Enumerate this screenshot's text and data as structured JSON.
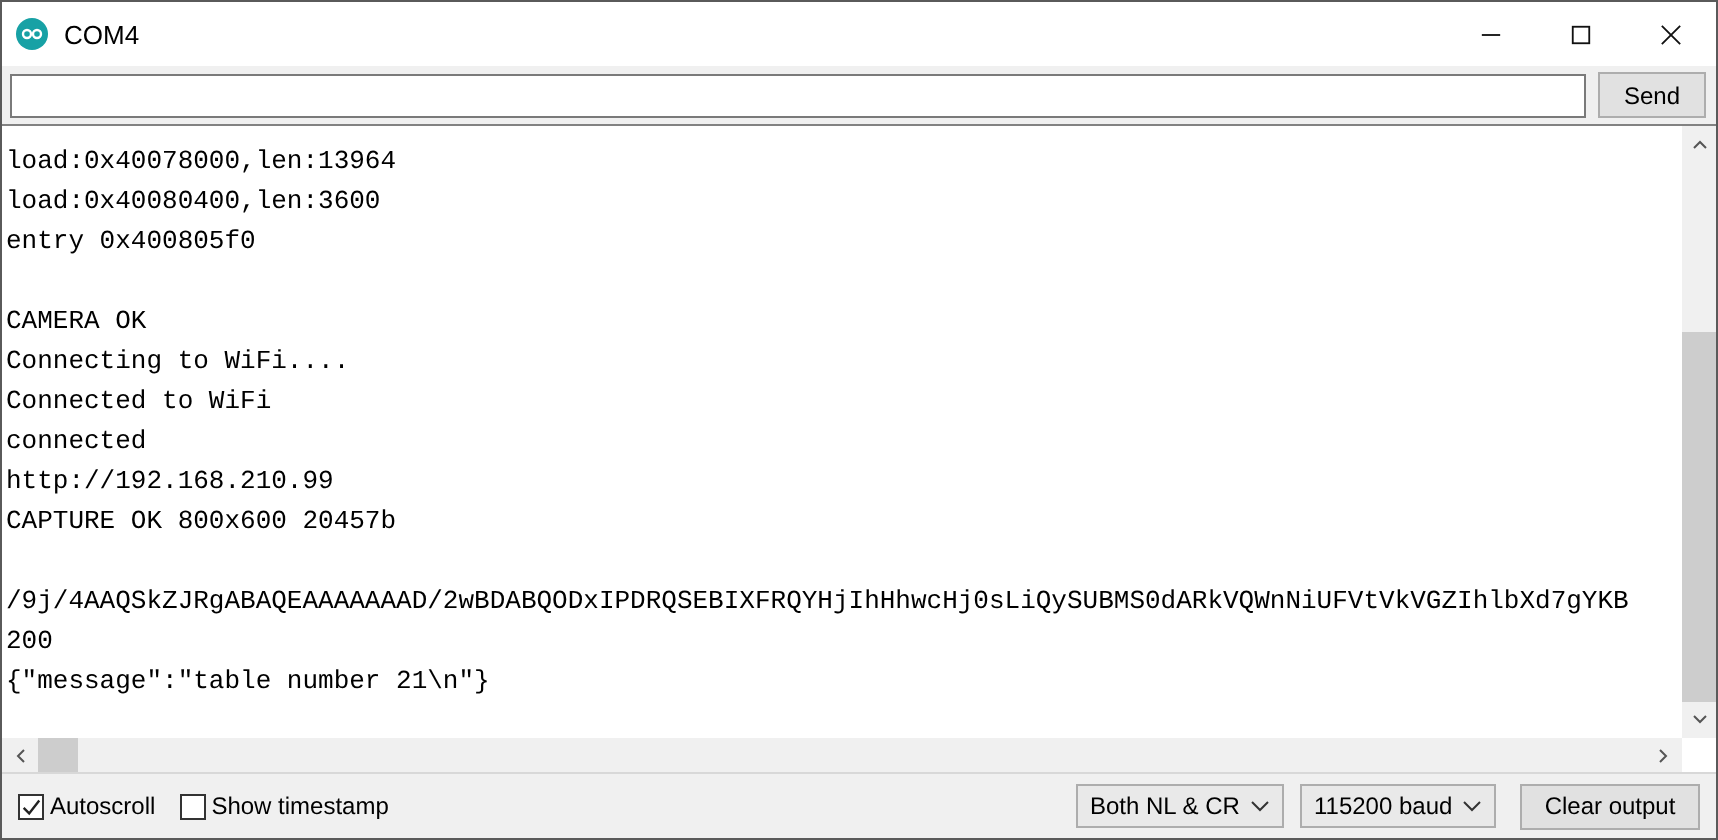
{
  "window": {
    "title": "COM4"
  },
  "send_button": "Send",
  "output_blocks": [
    [
      "load:0x40078000,len:13964",
      "load:0x40080400,len:3600",
      "entry 0x400805f0"
    ],
    [
      "CAMERA OK",
      "Connecting to WiFi....",
      "Connected to WiFi",
      "connected",
      "http://192.168.210.99",
      "CAPTURE OK 800x600 20457b"
    ],
    [
      "/9j/4AAQSkZJRgABAQEAAAAAAAD/2wBDABQODxIPDRQSEBIXFRQYHjIhHhwcHj0sLiQySUBMS0dARkVQWnNiUFVtVkVGZIhlbXd7gYKB",
      "200",
      "{\"message\":\"table number 21\\n\"}"
    ]
  ],
  "options": [
    {
      "label": "Autoscroll",
      "checked": true
    },
    {
      "label": "Show timestamp",
      "checked": false
    }
  ],
  "line_ending": "Both NL & CR",
  "baud": "115200 baud",
  "clear_button": "Clear output"
}
